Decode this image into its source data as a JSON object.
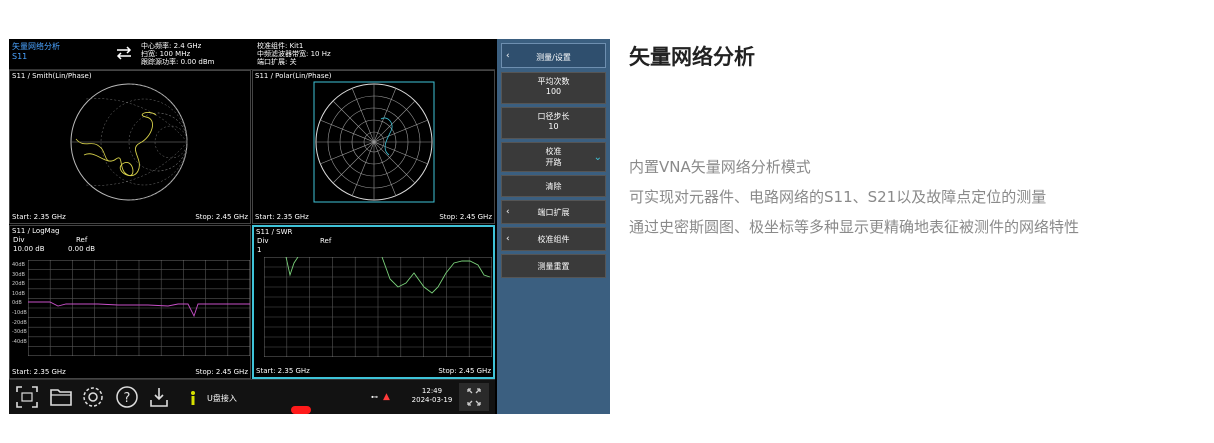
{
  "device": {
    "mode_title": "矢量网络分析",
    "mode_param": "S11",
    "center_freq": "中心频率: 2.4 GHz",
    "span": "扫宽: 100 MHz",
    "source_power": "跟踪源功率: 0.00 dBm",
    "cal_kit": "校准组件: Kit1",
    "if_bw": "中频滤波器带宽: 10 Hz",
    "port_ext": "端口扩展: 关"
  },
  "panels": {
    "smith": {
      "title": "S11 / Smith(Lin/Phase)",
      "start": "Start: 2.35 GHz",
      "stop": "Stop: 2.45 GHz"
    },
    "polar": {
      "title": "S11 / Polar(Lin/Phase)",
      "start": "Start: 2.35 GHz",
      "stop": "Stop: 2.45 GHz"
    },
    "logmag": {
      "title": "S11 / LogMag",
      "div_label": "Div",
      "ref_label": "Ref",
      "div_value": "10.00 dB",
      "ref_value": "0.00 dB",
      "ylabels": [
        "40dB",
        "30dB",
        "20dB",
        "10dB",
        "0dB",
        "-10dB",
        "-20dB",
        "-30dB",
        "-40dB"
      ],
      "start": "Start: 2.35 GHz",
      "stop": "Stop: 2.45 GHz"
    },
    "swr": {
      "title": "S11 / SWR",
      "div_label": "Div",
      "ref_label": "Ref",
      "div_value": "1",
      "start": "Start: 2.35 GHz",
      "stop": "Stop: 2.45 GHz"
    }
  },
  "softkeys": {
    "top": "测量/设置",
    "avg_label": "平均次数",
    "avg_value": "100",
    "aperture_label": "口径步长",
    "aperture_value": "10",
    "cal_label": "校准",
    "cal_value": "开路",
    "clear": "清除",
    "port_ext": "端口扩展",
    "cal_kit": "校准组件",
    "reset": "测量重置"
  },
  "statusbar": {
    "usb_msg": "U盘接入",
    "time": "12:49",
    "date": "2024-03-19"
  },
  "icons": [
    "screenshot-icon",
    "folder-icon",
    "settings-icon",
    "help-icon",
    "download-icon",
    "info-icon",
    "usb-icon",
    "warning-icon",
    "fullscreen-icon"
  ],
  "colors": {
    "accent": "#3fc3d8",
    "trace_yellow": "#d6d04a",
    "trace_magenta": "#c850c8",
    "trace_green": "#7ad07a",
    "softkey_panel": "#3b5f80"
  },
  "article": {
    "title": "矢量网络分析",
    "lines": [
      "内置VNA矢量网络分析模式",
      "可实现对元器件、电路网络的S11、S21以及故障点定位的测量",
      "通过史密斯圆图、极坐标等多种显示更精确地表征被测件的网络特性"
    ]
  }
}
